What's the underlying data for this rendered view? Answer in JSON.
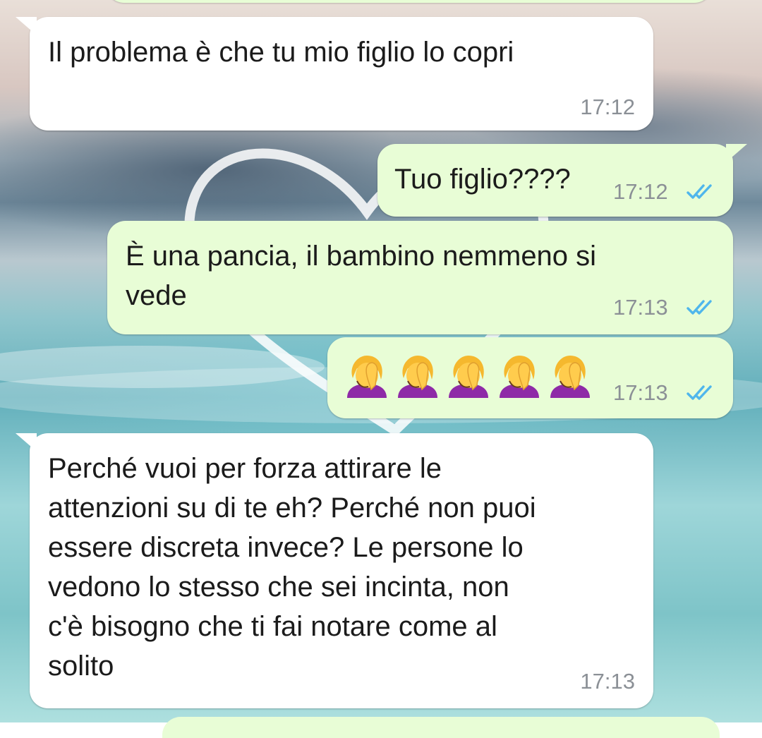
{
  "messages": [
    {
      "direction": "incoming",
      "text": "Il problema è che tu mio figlio lo copri",
      "time": "17:12"
    },
    {
      "direction": "outgoing",
      "text": "Tuo figlio????",
      "time": "17:12",
      "status": "read",
      "status_icon": "double-check-icon"
    },
    {
      "direction": "outgoing",
      "lines": [
        "È una pancia, il bambino nemmeno si",
        "vede"
      ],
      "time": "17:13",
      "status": "read",
      "status_icon": "double-check-icon"
    },
    {
      "direction": "outgoing",
      "emoji": [
        "face-palm-woman-icon",
        "face-palm-woman-icon",
        "face-palm-woman-icon",
        "face-palm-woman-icon",
        "face-palm-woman-icon"
      ],
      "time": "17:13",
      "status": "read",
      "status_icon": "double-check-icon"
    },
    {
      "direction": "incoming",
      "lines": [
        "Perché vuoi per forza attirare le",
        "attenzioni su di te eh? Perché non puoi",
        "essere discreta invece? Le persone lo",
        "vedono lo stesso che sei incinta, non",
        "c'è bisogno che ti fai notare come al",
        "solito"
      ],
      "time": "17:13"
    }
  ],
  "colors": {
    "incoming_bubble": "#ffffff",
    "outgoing_bubble": "#e8fdd6",
    "timestamp": "#8b9096",
    "read_ticks": "#4fb6ec"
  }
}
